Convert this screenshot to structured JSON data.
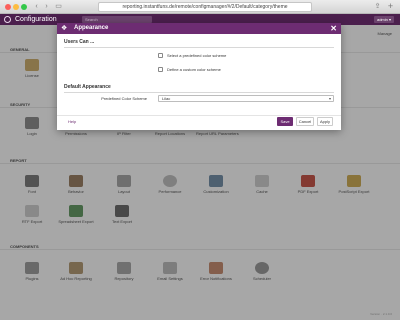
{
  "browser": {
    "url": "reporting.instantfuns.de/remote/configmanager/#/2/Default/category/theme",
    "share_icon": "share-icon",
    "new_tab_icon": "plus-icon"
  },
  "app": {
    "title": "Configuration",
    "search_placeholder": "Search",
    "user_label": "admin ▾",
    "brand_color": "#4b1f4d"
  },
  "page": {
    "manage_label": "Manage",
    "version": "Version · 2.1.0.0",
    "sections": [
      {
        "title": "GENERAL",
        "items": [
          {
            "label": "License",
            "icon": "license-icon"
          }
        ]
      },
      {
        "title": "SECURITY",
        "items": [
          {
            "label": "Login",
            "icon": "login-icon"
          },
          {
            "label": "Permissions",
            "icon": "permissions-icon"
          },
          {
            "label": "IP Filter",
            "icon": "ip-filter-icon"
          },
          {
            "label": "Report Locations",
            "icon": "report-locations-icon"
          },
          {
            "label": "Report URL Parameters",
            "icon": "report-url-parameters-icon"
          }
        ]
      },
      {
        "title": "REPORT",
        "items": [
          {
            "label": "Font",
            "icon": "font-icon"
          },
          {
            "label": "Behavior",
            "icon": "behavior-icon"
          },
          {
            "label": "Layout",
            "icon": "layout-icon"
          },
          {
            "label": "Performance",
            "icon": "performance-icon"
          },
          {
            "label": "Customization",
            "icon": "customization-icon"
          },
          {
            "label": "Cache",
            "icon": "cache-icon"
          },
          {
            "label": "PDF Export",
            "icon": "pdf-export-icon"
          },
          {
            "label": "PostScript Export",
            "icon": "postscript-export-icon"
          },
          {
            "label": "RTF Export",
            "icon": "rtf-export-icon"
          },
          {
            "label": "Spreadsheet Export",
            "icon": "spreadsheet-export-icon"
          },
          {
            "label": "Text Export",
            "icon": "text-export-icon"
          }
        ]
      },
      {
        "title": "COMPONENTS",
        "items": [
          {
            "label": "Plugins",
            "icon": "plugins-icon"
          },
          {
            "label": "Ad Hoc Reporting",
            "icon": "ad-hoc-reporting-icon"
          },
          {
            "label": "Repository",
            "icon": "repository-icon"
          },
          {
            "label": "Email Settings",
            "icon": "email-settings-icon"
          },
          {
            "label": "Error Notifications",
            "icon": "error-notifications-icon"
          },
          {
            "label": "Scheduler",
            "icon": "scheduler-icon"
          }
        ]
      }
    ]
  },
  "modal": {
    "title": "Appearance",
    "icon": "palette-icon",
    "close_icon": "close-icon",
    "users_can_title": "Users Can ...",
    "checkbox_predefined_label": "Select a predefined color scheme",
    "checkbox_predefined_checked": false,
    "checkbox_custom_label": "Define a custom color scheme",
    "checkbox_custom_checked": false,
    "default_appearance_title": "Default Appearance",
    "predefined_scheme_label": "Predefined Color Scheme",
    "predefined_scheme_value": "Lilac",
    "help_label": "Help",
    "save_label": "Save",
    "cancel_label": "Cancel",
    "apply_label": "Apply",
    "accent_color": "#6d2c72"
  }
}
